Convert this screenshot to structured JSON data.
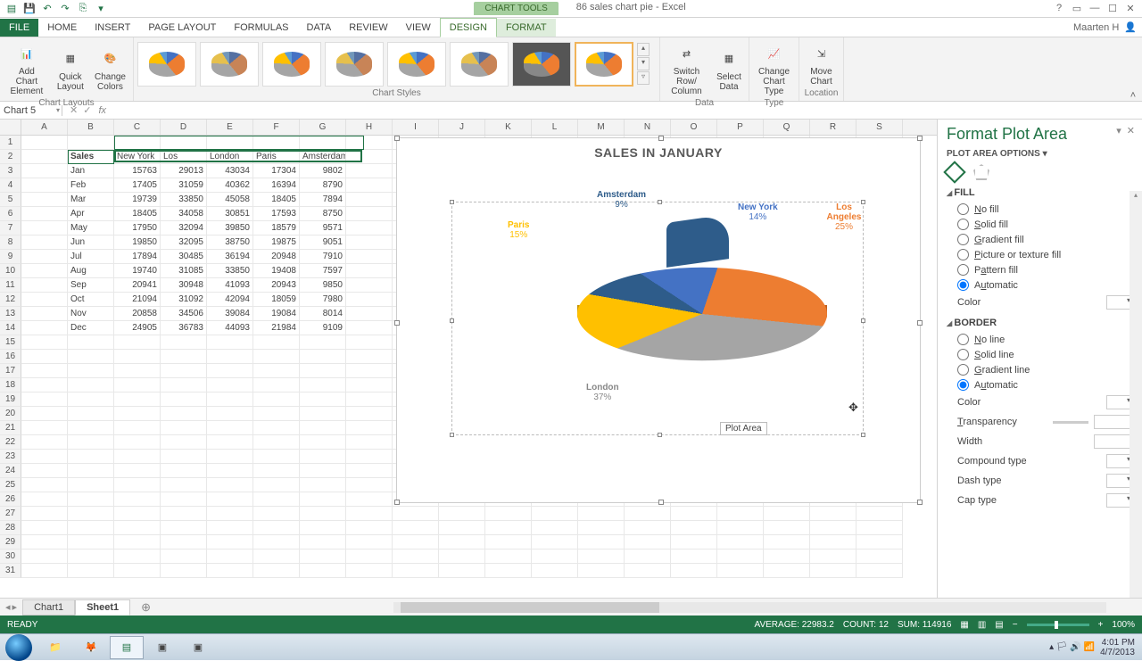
{
  "app": {
    "suite_tab": "CHART TOOLS",
    "doc_title": "86 sales chart pie - Excel",
    "user": "Maarten H"
  },
  "tabs": {
    "file": "FILE",
    "home": "HOME",
    "insert": "INSERT",
    "page_layout": "PAGE LAYOUT",
    "formulas": "FORMULAS",
    "data": "DATA",
    "review": "REVIEW",
    "view": "VIEW",
    "design": "DESIGN",
    "format": "FORMAT"
  },
  "ribbon": {
    "layouts_group": "Chart Layouts",
    "add_chart_element": "Add Chart\nElement",
    "quick_layout": "Quick\nLayout",
    "change_colors": "Change\nColors",
    "styles_group": "Chart Styles",
    "data_group": "Data",
    "switch_rc": "Switch Row/\nColumn",
    "select_data": "Select\nData",
    "type_group": "Type",
    "change_type": "Change\nChart Type",
    "location_group": "Location",
    "move_chart": "Move\nChart"
  },
  "namebox": "Chart 5",
  "columns": [
    "A",
    "B",
    "C",
    "D",
    "E",
    "F",
    "G",
    "H",
    "I",
    "J",
    "K",
    "L",
    "M",
    "N",
    "O",
    "P",
    "Q",
    "R",
    "S"
  ],
  "sheet": {
    "header_row": [
      "",
      "Sales",
      "New York",
      "Los Angeles",
      "London",
      "Paris",
      "Amsterdam"
    ],
    "data": [
      [
        "Jan",
        15763,
        29013,
        43034,
        17304,
        9802
      ],
      [
        "Feb",
        17405,
        31059,
        40362,
        16394,
        8790
      ],
      [
        "Mar",
        19739,
        33850,
        45058,
        18405,
        7894
      ],
      [
        "Apr",
        18405,
        34058,
        30851,
        17593,
        8750
      ],
      [
        "May",
        17950,
        32094,
        39850,
        18579,
        9571
      ],
      [
        "Jun",
        19850,
        32095,
        38750,
        19875,
        9051
      ],
      [
        "Jul",
        17894,
        30485,
        36194,
        20948,
        7910
      ],
      [
        "Aug",
        19740,
        31085,
        33850,
        19408,
        7597
      ],
      [
        "Sep",
        20941,
        30948,
        41093,
        20943,
        9850
      ],
      [
        "Oct",
        21094,
        31092,
        42094,
        18059,
        7980
      ],
      [
        "Nov",
        20858,
        34506,
        39084,
        19084,
        8014
      ],
      [
        "Dec",
        24905,
        36783,
        44093,
        21984,
        9109
      ]
    ]
  },
  "chart_data": {
    "type": "pie",
    "title": "SALES IN JANUARY",
    "categories": [
      "New York",
      "Los Angeles",
      "London",
      "Paris",
      "Amsterdam"
    ],
    "values": [
      15763,
      29013,
      43034,
      17304,
      9802
    ],
    "percent": [
      14,
      25,
      37,
      15,
      9
    ],
    "colors": [
      "#4472c4",
      "#ed7d31",
      "#a5a5a5",
      "#ffc000",
      "#2e5c8a"
    ],
    "tooltip": "Plot Area"
  },
  "dlabels": {
    "ny_name": "New York",
    "ny_pct": "14%",
    "la_name": "Los Angeles",
    "la_pct": "25%",
    "lon_name": "London",
    "lon_pct": "37%",
    "par_name": "Paris",
    "par_pct": "15%",
    "ams_name": "Amsterdam",
    "ams_pct": "9%"
  },
  "pane": {
    "title": "Format Plot Area",
    "subtitle": "PLOT AREA OPTIONS",
    "fill_hdr": "FILL",
    "no_fill": "No fill",
    "solid_fill": "Solid fill",
    "gradient_fill": "Gradient fill",
    "picture_fill": "Picture or texture fill",
    "pattern_fill": "Pattern fill",
    "automatic": "Automatic",
    "color": "Color",
    "border_hdr": "BORDER",
    "no_line": "No line",
    "solid_line": "Solid line",
    "gradient_line": "Gradient line",
    "transparency": "Transparency",
    "width": "Width",
    "compound": "Compound type",
    "dash": "Dash type",
    "cap": "Cap type"
  },
  "sheet_tabs": {
    "chart1": "Chart1",
    "sheet1": "Sheet1"
  },
  "status": {
    "ready": "READY",
    "avg": "AVERAGE: 22983.2",
    "count": "COUNT: 12",
    "sum": "SUM: 114916",
    "zoom": "100%"
  },
  "taskbar": {
    "time": "4:01 PM",
    "date": "4/7/2013"
  }
}
